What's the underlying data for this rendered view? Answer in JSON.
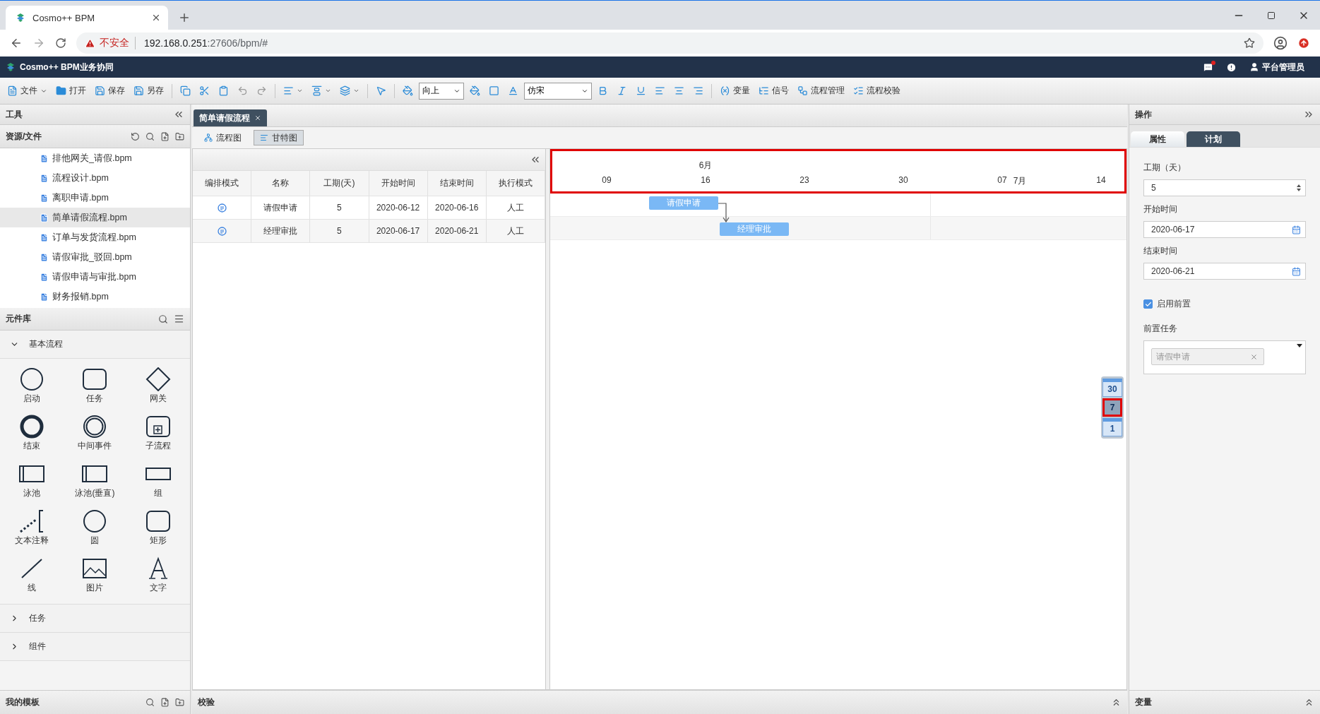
{
  "browser": {
    "tab_title": "Cosmo++ BPM",
    "url_warning": "不安全",
    "url_host": "192.168.0.251",
    "url_rest": ":27606/bpm/#"
  },
  "app": {
    "title": "Cosmo++ BPM业务协同",
    "user": "平台管理员"
  },
  "toolbar": {
    "file_menu": "文件",
    "open": "打开",
    "save": "保存",
    "save_as": "另存",
    "direction": "向上",
    "font": "仿宋",
    "variable": "变量",
    "signal": "信号",
    "process_manage": "流程管理",
    "process_check": "流程校验"
  },
  "left_panel": {
    "title": "工具",
    "resources": {
      "title": "资源/文件",
      "files": [
        {
          "name": "排他网关_请假.bpm",
          "selected": false
        },
        {
          "name": "流程设计.bpm",
          "selected": false
        },
        {
          "name": "离职申请.bpm",
          "selected": false
        },
        {
          "name": "简单请假流程.bpm",
          "selected": true
        },
        {
          "name": "订单与发货流程.bpm",
          "selected": false
        },
        {
          "name": "请假审批_驳回.bpm",
          "selected": false
        },
        {
          "name": "请假申请与审批.bpm",
          "selected": false
        },
        {
          "name": "财务报销.bpm",
          "selected": false
        }
      ]
    },
    "library": {
      "title": "元件库",
      "groups": [
        {
          "label": "基本流程",
          "expanded": true,
          "items": [
            {
              "kind": "start",
              "label": "启动"
            },
            {
              "kind": "task",
              "label": "任务"
            },
            {
              "kind": "gateway",
              "label": "网关"
            },
            {
              "kind": "end",
              "label": "结束"
            },
            {
              "kind": "intermediate",
              "label": "中间事件"
            },
            {
              "kind": "subprocess",
              "label": "子流程"
            },
            {
              "kind": "pool",
              "label": "泳池"
            },
            {
              "kind": "pool",
              "label": "泳池(垂直)"
            },
            {
              "kind": "group",
              "label": "组"
            },
            {
              "kind": "annotation",
              "label": "文本注释"
            },
            {
              "kind": "circle",
              "label": "圆"
            },
            {
              "kind": "task",
              "label": "矩形"
            },
            {
              "kind": "line",
              "label": "线"
            },
            {
              "kind": "image",
              "label": "图片"
            },
            {
              "kind": "text",
              "label": "文字"
            }
          ]
        },
        {
          "label": "任务",
          "expanded": false
        },
        {
          "label": "组件",
          "expanded": false
        }
      ]
    },
    "templates": "我的模板"
  },
  "doc_tabs": [
    {
      "label": "简单请假流程",
      "selected": true
    }
  ],
  "view_tabs": [
    {
      "label": "流程图",
      "selected": false
    },
    {
      "label": "甘特图",
      "selected": true
    }
  ],
  "table": {
    "columns": [
      "编排模式",
      "名称",
      "工期(天)",
      "开始时间",
      "结束时间",
      "执行模式"
    ],
    "rows": [
      {
        "name": "请假申请",
        "duration": "5",
        "start": "2020-06-12",
        "end": "2020-06-16",
        "mode": "人工"
      },
      {
        "name": "经理审批",
        "duration": "5",
        "start": "2020-06-17",
        "end": "2020-06-21",
        "mode": "人工"
      }
    ]
  },
  "gantt": {
    "header_highlighted": true,
    "bars": [
      {
        "label": "请假申请",
        "arrow_to_next": true
      },
      {
        "label": "经理审批",
        "arrow_to_next": false
      }
    ],
    "ticks": [
      {
        "label": "09"
      },
      {
        "label": "16",
        "month": "6月"
      },
      {
        "label": "23"
      },
      {
        "label": "30"
      },
      {
        "label": "07",
        "suffix": "7月"
      },
      {
        "label": "14"
      }
    ],
    "scales": [
      {
        "label": "30",
        "selected": false
      },
      {
        "label": "7",
        "selected": true
      },
      {
        "label": "1",
        "selected": false
      }
    ]
  },
  "right_panel": {
    "title": "操作",
    "tabs": [
      {
        "label": "属性",
        "selected": false
      },
      {
        "label": "计划",
        "selected": true
      }
    ],
    "duration": {
      "label": "工期（天）",
      "value": "5"
    },
    "start": {
      "label": "开始时间",
      "value": "2020-06-17"
    },
    "end": {
      "label": "结束时间",
      "value": "2020-06-21"
    },
    "predecessor_enabled": {
      "label": "启用前置",
      "checked": true
    },
    "predecessors": {
      "label": "前置任务",
      "tags": [
        "请假申请"
      ]
    }
  },
  "bottom": {
    "check": "校验",
    "variables": "变量"
  }
}
